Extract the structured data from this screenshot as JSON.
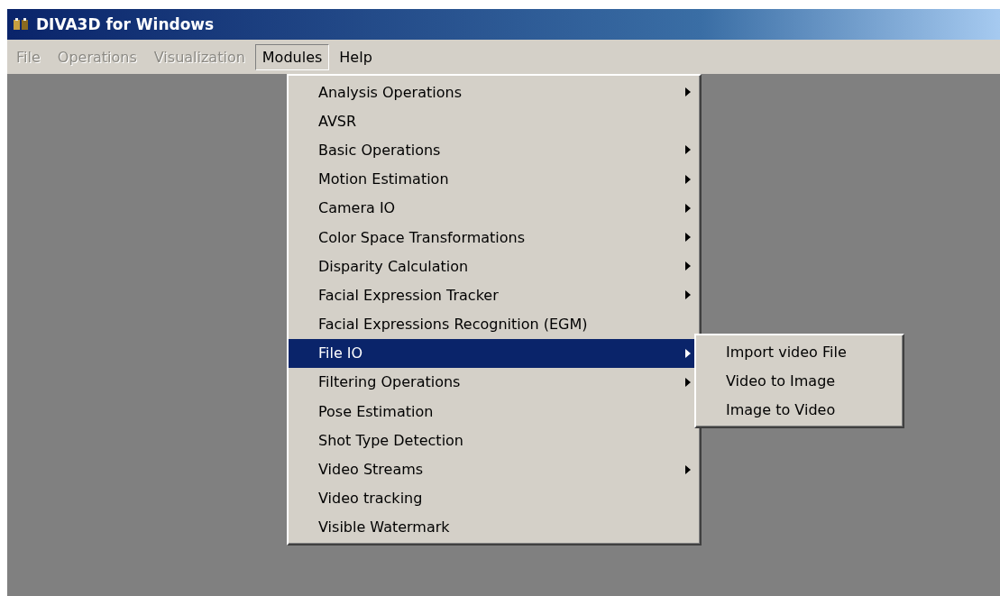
{
  "window": {
    "title": "DIVA3D for Windows"
  },
  "menubar": [
    {
      "label": "File",
      "disabled": true,
      "selected": false
    },
    {
      "label": "Operations",
      "disabled": true,
      "selected": false
    },
    {
      "label": "Visualization",
      "disabled": true,
      "selected": false
    },
    {
      "label": "Modules",
      "disabled": false,
      "selected": true
    },
    {
      "label": "Help",
      "disabled": false,
      "selected": false
    }
  ],
  "menu": {
    "items": [
      {
        "label": "Analysis Operations",
        "submenu": true,
        "selected": false
      },
      {
        "label": "AVSR",
        "submenu": false,
        "selected": false
      },
      {
        "label": "Basic Operations",
        "submenu": true,
        "selected": false
      },
      {
        "label": "Motion Estimation",
        "submenu": true,
        "selected": false
      },
      {
        "label": "Camera IO",
        "submenu": true,
        "selected": false
      },
      {
        "label": "Color Space Transformations",
        "submenu": true,
        "selected": false
      },
      {
        "label": "Disparity Calculation",
        "submenu": true,
        "selected": false
      },
      {
        "label": "Facial Expression Tracker",
        "submenu": true,
        "selected": false
      },
      {
        "label": "Facial Expressions Recognition (EGM)",
        "submenu": false,
        "selected": false
      },
      {
        "label": "File IO",
        "submenu": true,
        "selected": true
      },
      {
        "label": "Filtering Operations",
        "submenu": true,
        "selected": false
      },
      {
        "label": "Pose Estimation",
        "submenu": false,
        "selected": false
      },
      {
        "label": "Shot Type Detection",
        "submenu": false,
        "selected": false
      },
      {
        "label": "Video Streams",
        "submenu": true,
        "selected": false
      },
      {
        "label": "Video tracking",
        "submenu": false,
        "selected": false
      },
      {
        "label": "Visible Watermark",
        "submenu": false,
        "selected": false
      }
    ]
  },
  "submenu": {
    "items": [
      {
        "label": "Import video File"
      },
      {
        "label": "Video to Image"
      },
      {
        "label": "Image to Video"
      }
    ]
  }
}
